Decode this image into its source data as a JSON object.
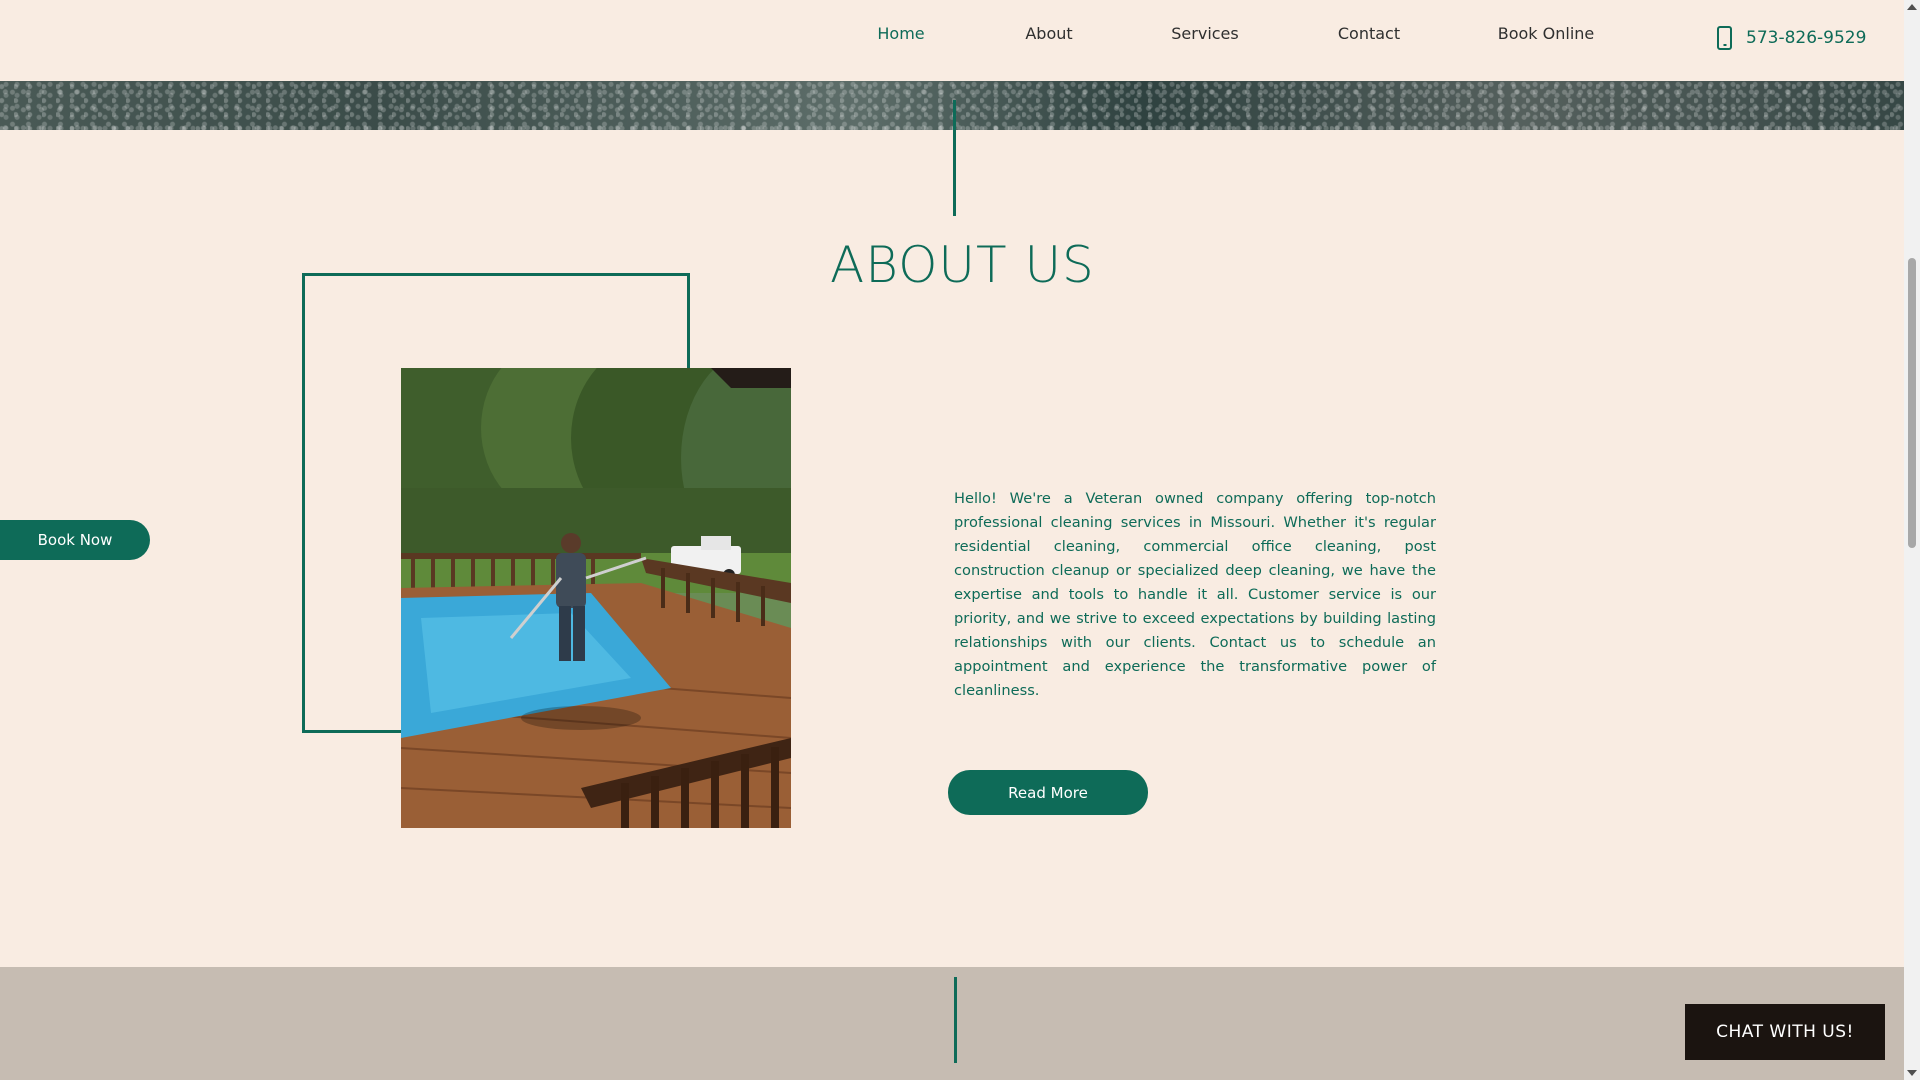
{
  "nav": {
    "items": [
      {
        "label": "Home",
        "active": true
      },
      {
        "label": "About"
      },
      {
        "label": "Services"
      },
      {
        "label": "Contact"
      },
      {
        "label": "Book Online"
      }
    ],
    "phone": "573-826-9529"
  },
  "about": {
    "title": "ABOUT US",
    "body": "Hello! We're a Veteran owned company offering top-notch professional cleaning services in Missouri. Whether it's regular residential cleaning, commercial office cleaning, post construction cleanup or specialized deep cleaning, we have the expertise and tools to handle it all. Customer service is our priority, and we strive to exceed expectations by building lasting relationships with our clients. Contact us to schedule an appointment and experience the transformative power of cleanliness.",
    "read_more_label": "Read More"
  },
  "book_now_label": "Book Now",
  "chat_label": "CHAT WITH US!",
  "colors": {
    "accent": "#0e6b58",
    "background": "#f9ece2",
    "lower_section": "#c6bcb2",
    "chat_bg": "#1b1410"
  }
}
